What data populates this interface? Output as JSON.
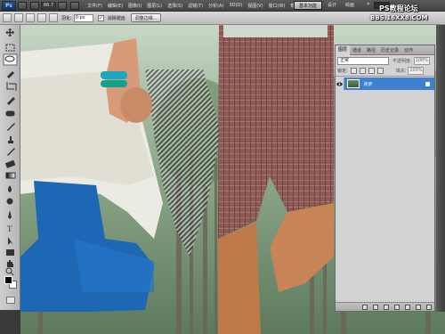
{
  "app": {
    "logo": "Ps"
  },
  "menubar": {
    "items": [
      "文件(F)",
      "编辑(E)",
      "图像(I)",
      "图层(L)",
      "选择(S)",
      "滤镜(T)",
      "分析(A)",
      "3D(D)",
      "视图(V)",
      "窗口(W)",
      "帮助(H)"
    ],
    "zoom": "66.7",
    "workspace_active": "基本功能",
    "workspace_design": "设计",
    "workspace_paint": "绘画",
    "workspace_more": "»"
  },
  "options_bar": {
    "feather_label": "羽化:",
    "feather_value": "0 px",
    "antialias_checked": "✓",
    "antialias_label": "消除锯齿",
    "refine_label": "调整边缘..."
  },
  "layers_panel": {
    "tabs": [
      "图层",
      "通道",
      "路径",
      "历史记录",
      "动作"
    ],
    "blend_mode": "正常",
    "opacity_label": "不透明度:",
    "opacity_value": "100%",
    "lock_label": "锁定:",
    "fill_label": "填充:",
    "fill_value": "100%",
    "layer_name": "背景"
  },
  "watermark": {
    "title": "PS教程论坛",
    "url": "BBS.16XX8.COM"
  },
  "colors": {
    "selection_blue": "#3f80d0",
    "fg": "#000000",
    "bg": "#ffffff"
  },
  "icons": [
    "ps-logo-icon",
    "lasso-icon",
    "move-icon",
    "marquee-icon",
    "quick-select-icon",
    "crop-icon",
    "eyedropper-icon",
    "brush-icon",
    "eraser-icon",
    "pen-icon",
    "type-icon",
    "hand-icon",
    "zoom-icon",
    "eye-icon",
    "lock-icon"
  ]
}
